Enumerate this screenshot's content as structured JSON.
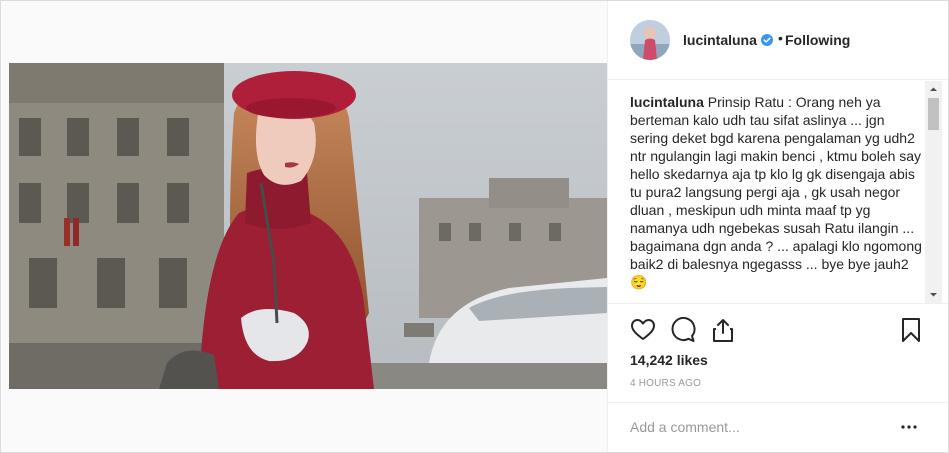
{
  "post": {
    "username": "lucintaluna",
    "follow_separator": "•",
    "follow_status": "Following",
    "caption": {
      "username": "lucintaluna",
      "text": "Prinsip Ratu : Orang neh ya berteman kalo udh tau sifat aslinya ... jgn sering deket bgd karena pengalaman yg udh2 ntr ngulangin lagi makin benci , ktmu boleh say hello skedarnya aja tp klo lg gk disengaja abis tu pura2 langsung pergi aja , gk usah negor dluan , meskipun udh minta maaf tp yg namanya udh ngebekas susah Ratu ilangin ... bagaimana dgn anda ? ... apalagi klo ngomong baik2 di balesnya ngegasss ... bye bye jauh2 😌"
    },
    "likes": "14,242 likes",
    "time": "4 HOURS AGO",
    "comment_placeholder": "Add a comment..."
  },
  "icons": {
    "verified": "verified-badge-icon",
    "like": "heart-icon",
    "comment": "comment-bubble-icon",
    "share": "share-icon",
    "save": "bookmark-icon",
    "more": "more-options-icon"
  },
  "colors": {
    "verified_blue": "#3897f0",
    "text": "#262626",
    "muted": "#999999",
    "border": "#efefef"
  }
}
